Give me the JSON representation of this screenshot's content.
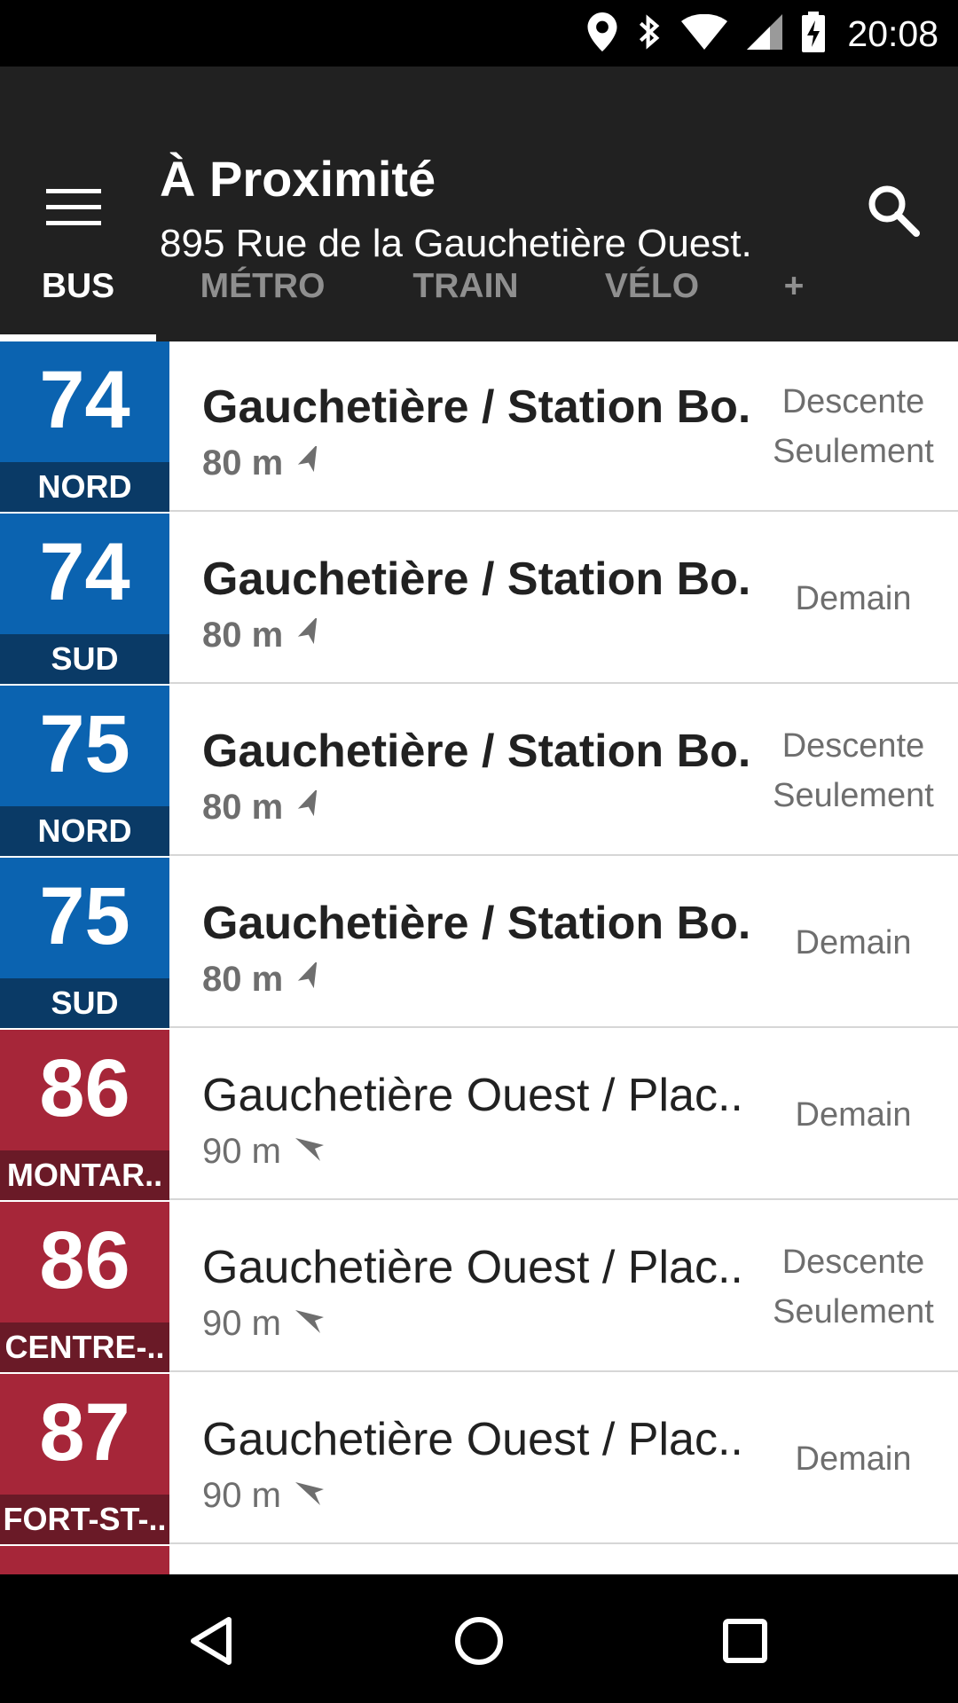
{
  "status_bar": {
    "time": "20:08",
    "icons": [
      "location-icon",
      "bluetooth-icon",
      "wifi-icon",
      "signal-icon",
      "battery-charging-icon"
    ]
  },
  "app_bar": {
    "title": "À Proximité",
    "subtitle": "895 Rue de la Gauchetière Ouest.",
    "menu_icon": "hamburger-menu-icon",
    "search_icon": "search-icon"
  },
  "tabs": [
    {
      "label": "BUS",
      "active": true
    },
    {
      "label": "MÉTRO",
      "active": false
    },
    {
      "label": "TRAIN",
      "active": false
    },
    {
      "label": "VÉLO",
      "active": false
    },
    {
      "label": "+",
      "active": false
    }
  ],
  "colors": {
    "status_bar": "#000000",
    "app_bar": "#212121",
    "stm_blue": "#0b63b0",
    "stm_blue_dark": "#0a3a66",
    "stm_red": "#a62639",
    "stm_red_dark": "#6a1a27",
    "nav_bar": "#000000"
  },
  "routes": [
    {
      "number": "74",
      "direction": "NORD",
      "color": "blue",
      "stop": "Gauchetière / Station Bo..",
      "distance": "80 m",
      "status": [
        "Descente",
        "Seulement"
      ],
      "bold": true
    },
    {
      "number": "74",
      "direction": "SUD",
      "color": "blue",
      "stop": "Gauchetière / Station Bo..",
      "distance": "80 m",
      "status": [
        "Demain"
      ],
      "bold": true
    },
    {
      "number": "75",
      "direction": "NORD",
      "color": "blue",
      "stop": "Gauchetière / Station Bo..",
      "distance": "80 m",
      "status": [
        "Descente",
        "Seulement"
      ],
      "bold": true
    },
    {
      "number": "75",
      "direction": "SUD",
      "color": "blue",
      "stop": "Gauchetière / Station Bo..",
      "distance": "80 m",
      "status": [
        "Demain"
      ],
      "bold": true
    },
    {
      "number": "86",
      "direction": "MONTAR..",
      "color": "red",
      "stop": "Gauchetière Ouest / Plac..",
      "distance": "90 m",
      "status": [
        "Demain"
      ],
      "bold": false
    },
    {
      "number": "86",
      "direction": "CENTRE-..",
      "color": "red",
      "stop": "Gauchetière Ouest / Plac..",
      "distance": "90 m",
      "status": [
        "Descente",
        "Seulement"
      ],
      "bold": false
    },
    {
      "number": "87",
      "direction": "FORT-ST-..",
      "color": "red",
      "stop": "Gauchetière Ouest / Plac..",
      "distance": "90 m",
      "status": [
        "Demain"
      ],
      "bold": false
    }
  ],
  "nav_bar": {
    "icons": [
      "back-icon",
      "home-icon",
      "recents-icon"
    ]
  }
}
